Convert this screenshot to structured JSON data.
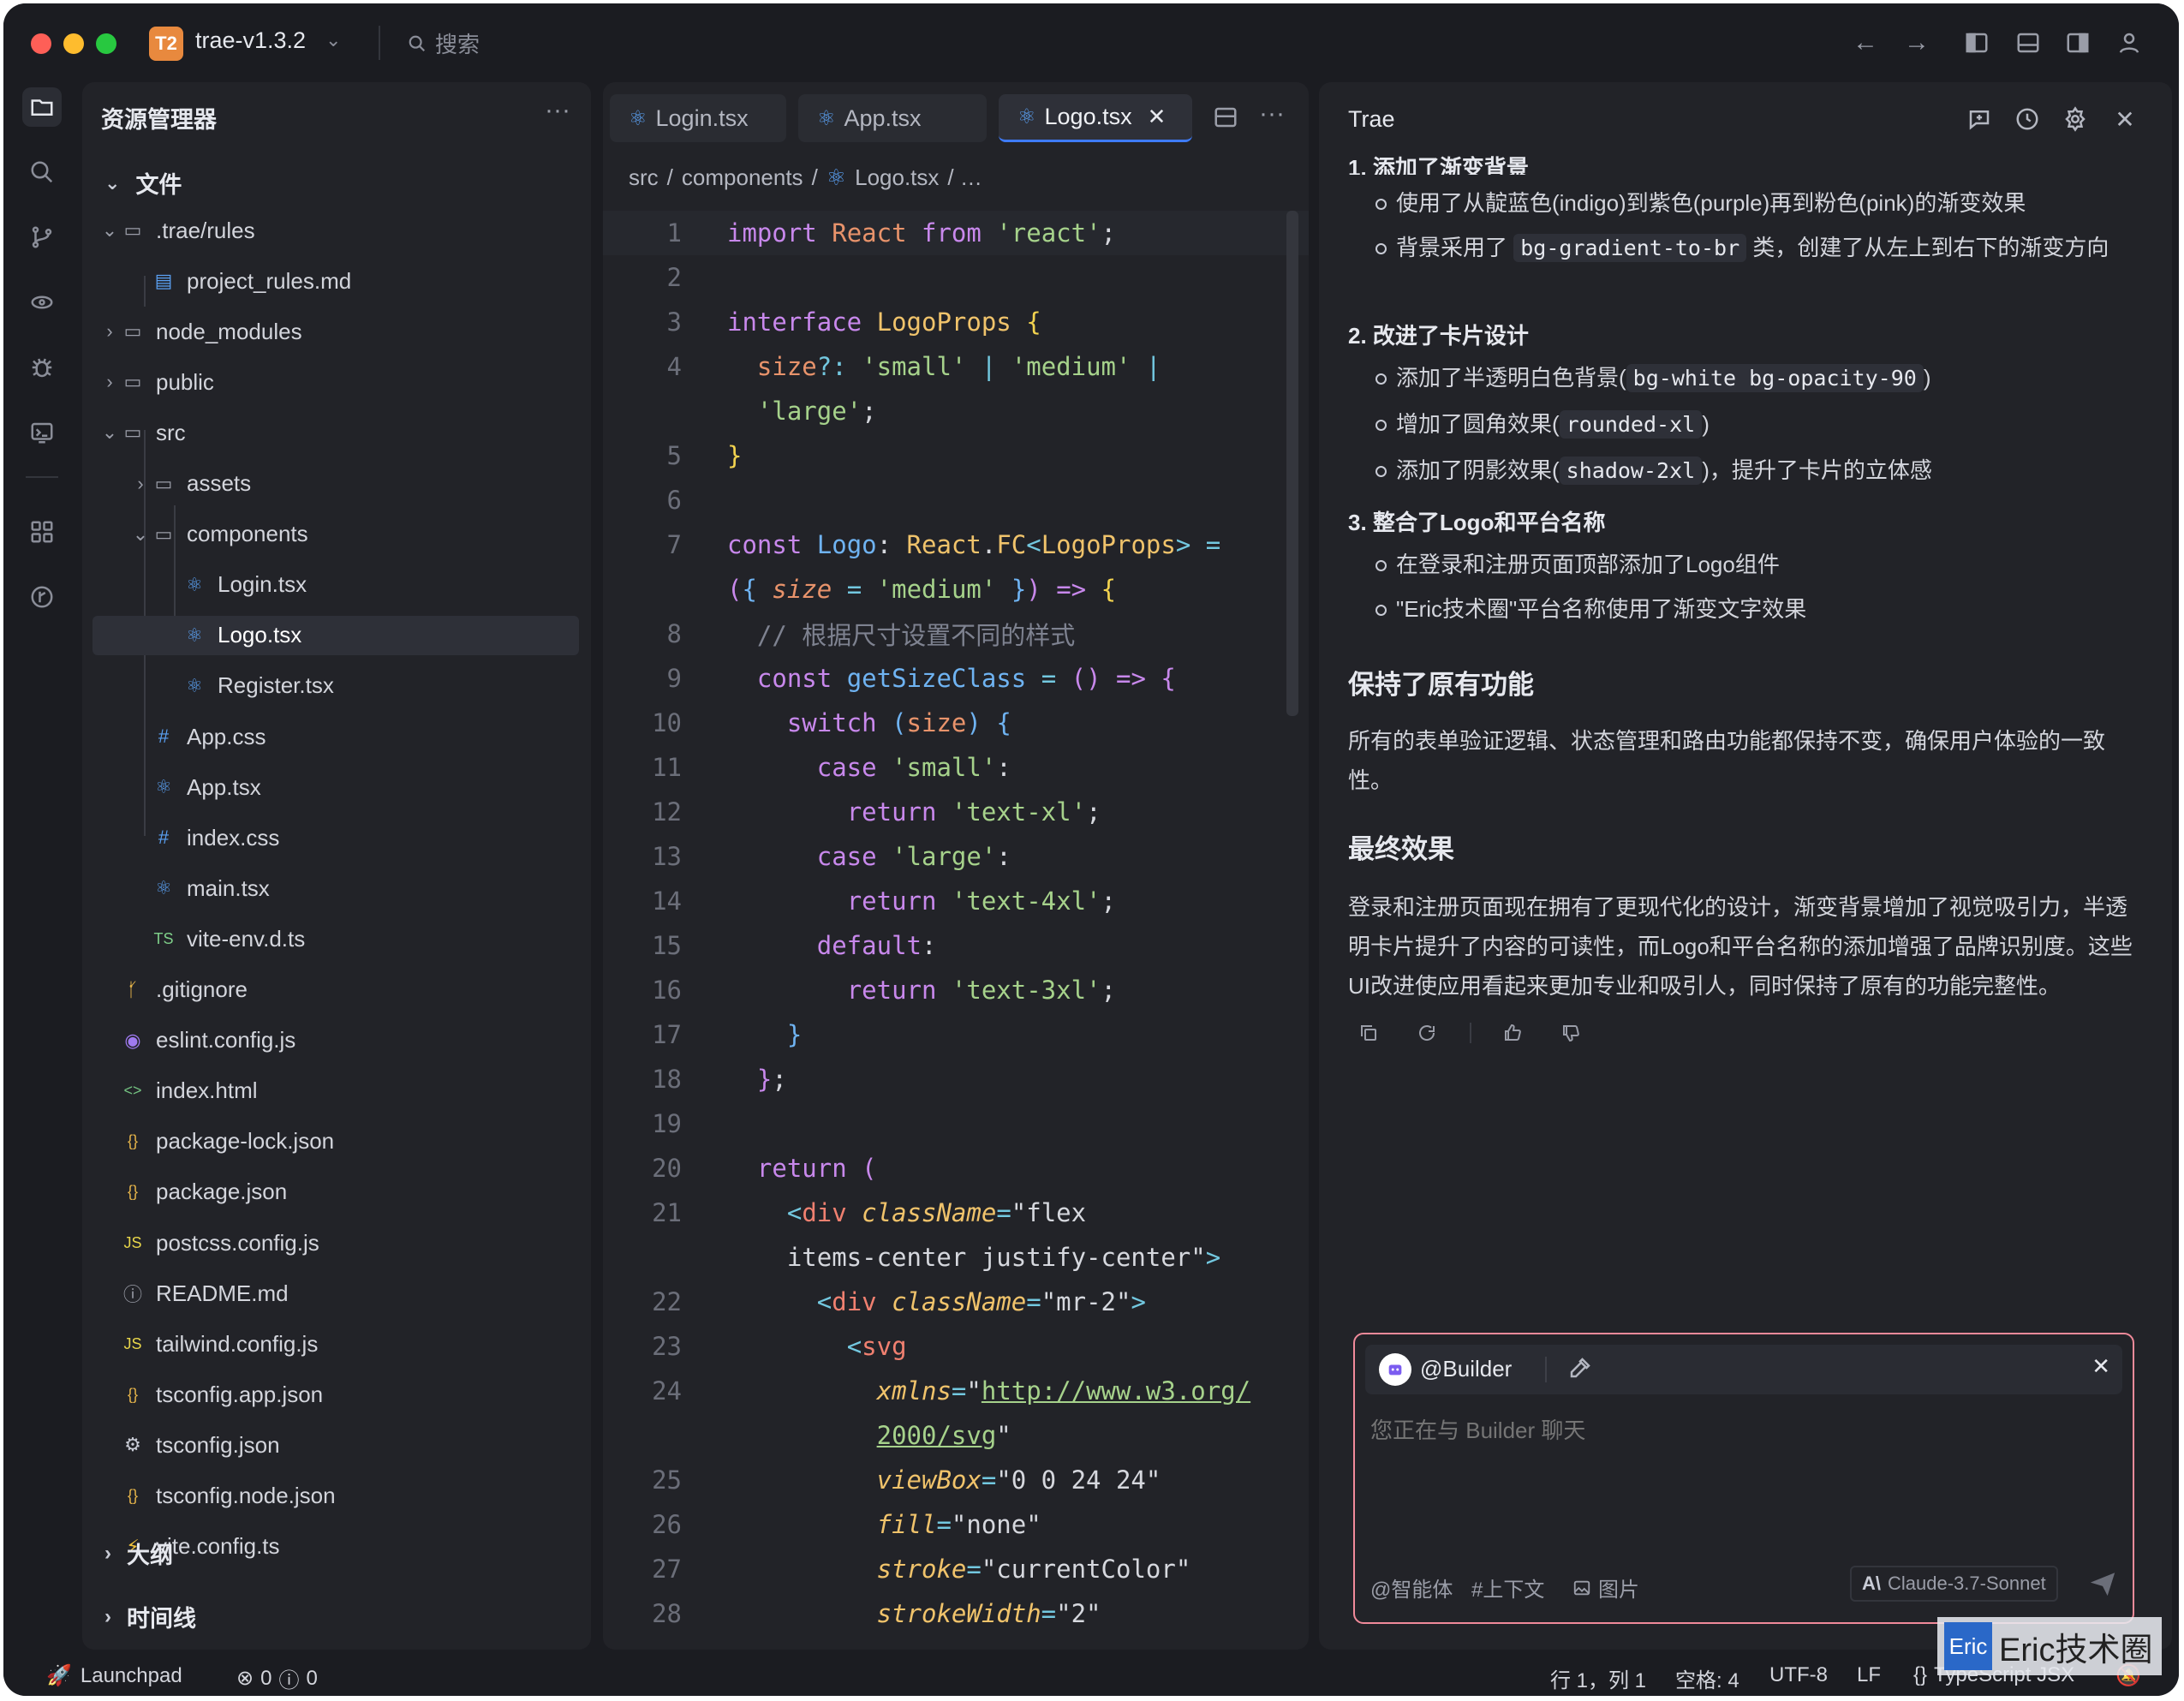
{
  "titlebar": {
    "badge": "T2",
    "project": "trae-v1.3.2",
    "search": "搜索"
  },
  "sidebar": {
    "title": "资源管理器",
    "section": "文件",
    "items": [
      {
        "label": ".trae/rules",
        "icon": "folder-open-icon"
      },
      {
        "label": "project_rules.md",
        "icon": "markdown-icon"
      },
      {
        "label": "node_modules",
        "icon": "folder-icon"
      },
      {
        "label": "public",
        "icon": "folder-icon"
      },
      {
        "label": "src",
        "icon": "folder-open-icon"
      },
      {
        "label": "assets",
        "icon": "folder-icon"
      },
      {
        "label": "components",
        "icon": "folder-open-icon"
      },
      {
        "label": "Login.tsx",
        "icon": "react-icon"
      },
      {
        "label": "Logo.tsx",
        "icon": "react-icon"
      },
      {
        "label": "Register.tsx",
        "icon": "react-icon"
      },
      {
        "label": "App.css",
        "icon": "css-icon"
      },
      {
        "label": "App.tsx",
        "icon": "react-icon"
      },
      {
        "label": "index.css",
        "icon": "css-icon"
      },
      {
        "label": "main.tsx",
        "icon": "react-icon"
      },
      {
        "label": "vite-env.d.ts",
        "icon": "typescript-icon"
      },
      {
        "label": ".gitignore",
        "icon": "git-icon"
      },
      {
        "label": "eslint.config.js",
        "icon": "eslint-icon"
      },
      {
        "label": "index.html",
        "icon": "html-icon"
      },
      {
        "label": "package-lock.json",
        "icon": "json-icon"
      },
      {
        "label": "package.json",
        "icon": "json-icon"
      },
      {
        "label": "postcss.config.js",
        "icon": "js-icon"
      },
      {
        "label": "README.md",
        "icon": "info-icon"
      },
      {
        "label": "tailwind.config.js",
        "icon": "js-icon"
      },
      {
        "label": "tsconfig.app.json",
        "icon": "json-icon"
      },
      {
        "label": "tsconfig.json",
        "icon": "gear-icon"
      },
      {
        "label": "tsconfig.node.json",
        "icon": "json-icon"
      },
      {
        "label": "vite.config.ts",
        "icon": "vite-icon"
      }
    ],
    "outline": "大纲",
    "timeline": "时间线"
  },
  "editor": {
    "tabs": [
      {
        "label": "Login.tsx"
      },
      {
        "label": "App.tsx"
      },
      {
        "label": "Logo.tsx"
      }
    ],
    "breadcrumb": [
      "src",
      "components",
      "Logo.tsx"
    ],
    "line_numbers": [
      "1",
      "2",
      "3",
      "4",
      "",
      "5",
      "6",
      "7",
      "",
      "8",
      "9",
      "10",
      "11",
      "12",
      "13",
      "14",
      "15",
      "16",
      "17",
      "18",
      "19",
      "20",
      "21",
      "",
      "22",
      "23",
      "24",
      "",
      "25",
      "26",
      "27",
      "28"
    ]
  },
  "chat": {
    "title": "Trae",
    "item1_title": "添加了渐变背景",
    "item1_b1": "使用了从靛蓝色(indigo)到紫色(purple)再到粉色(pink)的渐变效果",
    "item1_b2_pre": "背景采用了",
    "item1_b2_code": "bg-gradient-to-br",
    "item1_b2_post": "类，创建了从左上到右下的渐变方向",
    "item2_title": "改进了卡片设计",
    "item2_b1_pre": "添加了半透明白色背景(",
    "item2_b1_code": "bg-white bg-opacity-90",
    "item2_b1_post": ")",
    "item2_b2_pre": "增加了圆角效果(",
    "item2_b2_code": "rounded-xl",
    "item2_b2_post": ")",
    "item2_b3_pre": "添加了阴影效果(",
    "item2_b3_code": "shadow-2xl",
    "item2_b3_post": ")，提升了卡片的立体感",
    "item3_title": "整合了Logo和平台名称",
    "item3_b1": "在登录和注册页面顶部添加了Logo组件",
    "item3_b2": "\"Eric技术圈\"平台名称使用了渐变文字效果",
    "h_keep": "保持了原有功能",
    "p_keep": "所有的表单验证逻辑、状态管理和路由功能都保持不变，确保用户体验的一致性。",
    "h_final": "最终效果",
    "p_final": "登录和注册页面现在拥有了更现代化的设计，渐变背景增加了视觉吸引力，半透明卡片提升了内容的可读性，而Logo和平台名称的添加增强了品牌识别度。这些UI改进使应用看起来更加专业和吸引人，同时保持了原有的功能完整性。",
    "input": {
      "agent": "@Builder",
      "placeholder": "您正在与 Builder 聊天",
      "agent_btn": "@智能体",
      "context_btn": "#上下文",
      "image_btn": "图片",
      "model": "Claude-3.7-Sonnet"
    }
  },
  "status": {
    "launchpad": "Launchpad",
    "errors": "0",
    "warnings": "0",
    "position": "行 1，列 1",
    "spaces": "空格: 4",
    "encoding": "UTF-8",
    "eol": "LF",
    "language": "TypeScript JSX"
  },
  "watermark": {
    "logo": "Eric",
    "text": "Eric技术圈"
  },
  "colors": {
    "accent": "#3e7bfa",
    "badge": "#e8893e",
    "input_border": "#f08a9a"
  }
}
